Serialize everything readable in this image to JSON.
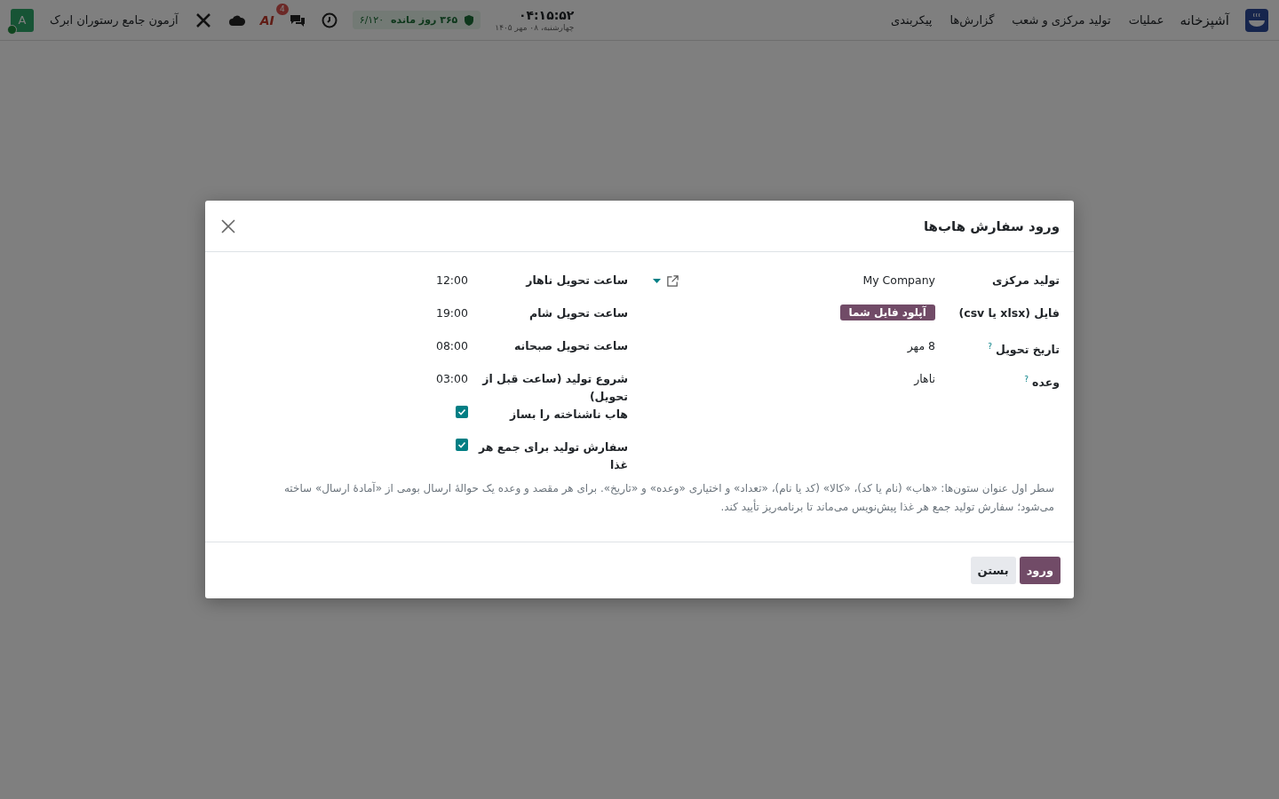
{
  "navbar": {
    "app_name": "آشپزخانه",
    "menu": [
      {
        "label": "عملیات"
      },
      {
        "label": "تولید مرکزی و شعب"
      },
      {
        "label": "گزارش‌ها"
      },
      {
        "label": "پیکربندی"
      }
    ],
    "systray": {
      "ai_logo": "AI",
      "chat_badge": "4",
      "subscription": {
        "days": "۳۶۵ روز مانده",
        "quota": "۶/۱۲۰"
      },
      "time": "۰۴:۱۵:۵۲",
      "date": "چهارشنبه، ۰۸ مهر ۱۴۰۵",
      "company": "آزمون جامع رستوران ابرک",
      "avatar": "A",
      "online": true
    }
  },
  "dialog": {
    "title": "ورود سفارش هاب‌ها",
    "left_fields": [
      {
        "label": "تولید مرکزی",
        "kind": "many2one",
        "value": "My Company"
      },
      {
        "label": "فایل (xlsx یا csv)",
        "kind": "upload",
        "value": "آپلود فایل شما"
      },
      {
        "label": "تاریخ تحویل",
        "kind": "text",
        "help": "?",
        "value": "8 مهر"
      },
      {
        "label": "وعده",
        "kind": "text",
        "help": "?",
        "value": "ناهار"
      }
    ],
    "right_fields": [
      {
        "label": "ساعت تحویل ناهار",
        "kind": "text",
        "value": "12:00"
      },
      {
        "label": "ساعت تحویل شام",
        "kind": "text",
        "value": "19:00"
      },
      {
        "label": "ساعت تحویل صبحانه",
        "kind": "text",
        "value": "08:00"
      },
      {
        "label": "شروع تولید (ساعت قبل از تحویل)",
        "kind": "text",
        "value": "03:00"
      },
      {
        "label": "هاب ناشناخته را بساز",
        "kind": "checkbox",
        "checked": true
      },
      {
        "label": "سفارش تولید برای جمع هر غذا",
        "kind": "checkbox",
        "checked": true
      }
    ],
    "note": "سطر اول عنوان ستون‌ها: «هاب» (نام یا کد)، «کالا» (کد یا نام)، «تعداد» و اختیاری «وعده» و «تاریخ». برای هر مقصد و وعده یک حوالهٔ ارسال بومی از «آمادهٔ ارسال» ساخته می‌شود؛ سفارش تولید جمع هر غذا پیش‌نویس می‌ماند تا برنامه‌ریز تأیید کند.",
    "buttons": [
      {
        "label": "ورود",
        "kind": "primary"
      },
      {
        "label": "بستن",
        "kind": "secondary"
      }
    ]
  }
}
